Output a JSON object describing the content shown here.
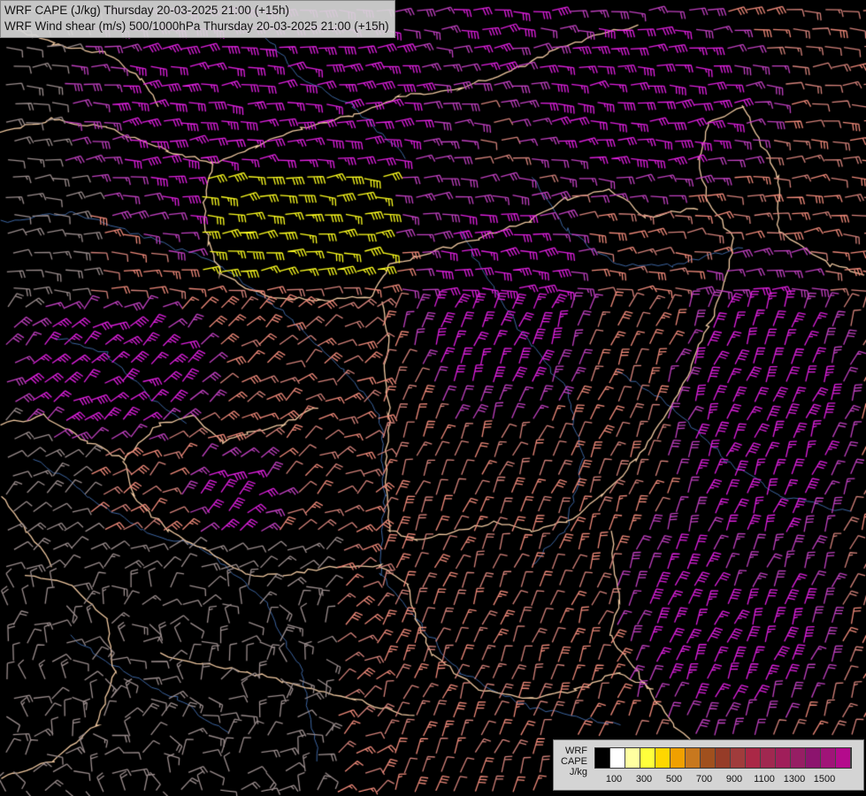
{
  "title": {
    "line1": "WRF CAPE (J/kg) Thursday 20-03-2025 21:00 (+15h)",
    "line2": "WRF Wind shear (m/s) 500/1000hPa Thursday 20-03-2025 21:00 (+15h)"
  },
  "legend": {
    "title_lines": [
      "WRF",
      "CAPE",
      "J/kg"
    ],
    "swatches": [
      "#000000",
      "#ffffff",
      "#ffffa0",
      "#ffff3c",
      "#ffd700",
      "#f0a000",
      "#c8781e",
      "#a0501e",
      "#963c28",
      "#a03c3c",
      "#aa2846",
      "#a02850",
      "#a01e5a",
      "#961e64",
      "#8c146e",
      "#a01478",
      "#b40a8c"
    ],
    "ticks": [
      "100",
      "300",
      "500",
      "700",
      "900",
      "1100",
      "1300",
      "1500"
    ]
  },
  "colors": {
    "background": "#000000",
    "border_line": "#f0c8a0",
    "river_line": "#3c64a0",
    "barb_gray": "#9a8c8c",
    "barb_salmon": "#d4827a",
    "barb_coral": "#f08a7a",
    "barb_magenta": "#e020e0",
    "barb_purple": "#c040c0",
    "barb_yellow": "#ffff20"
  },
  "map": {
    "layer_wind_barbs": "wind-shear-barbs",
    "layer_borders": "country-borders",
    "layer_rivers": "rivers"
  }
}
